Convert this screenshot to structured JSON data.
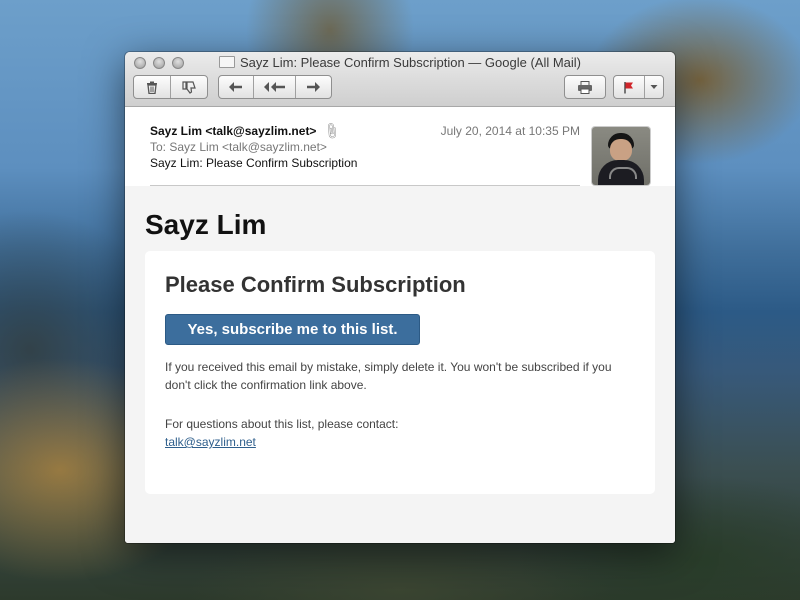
{
  "window": {
    "title": "Sayz Lim: Please Confirm Subscription — Google (All Mail)"
  },
  "toolbar": {
    "icons": [
      "trash-icon",
      "junk-thumbs-down-icon",
      "reply-icon",
      "reply-all-icon",
      "forward-icon",
      "print-icon",
      "flag-icon",
      "chevron-down-icon"
    ],
    "flag_color": "#d0252a"
  },
  "email": {
    "from": "Sayz Lim <talk@sayzlim.net>",
    "to": "To:  Sayz Lim <talk@sayzlim.net>",
    "subject": "Sayz Lim: Please Confirm Subscription",
    "date": "July 20, 2014 at 10:35 PM"
  },
  "body": {
    "sender_name": "Sayz Lim",
    "card_title": "Please Confirm Subscription",
    "button_label": "Yes, subscribe me to this list.",
    "button_color": "#3c6e9d",
    "note": "If you received this email by mistake, simply delete it. You won't be subscribed if you don't click the confirmation link above.",
    "contact_label": "For questions about this list, please contact:",
    "contact_email": "talk@sayzlim.net"
  }
}
